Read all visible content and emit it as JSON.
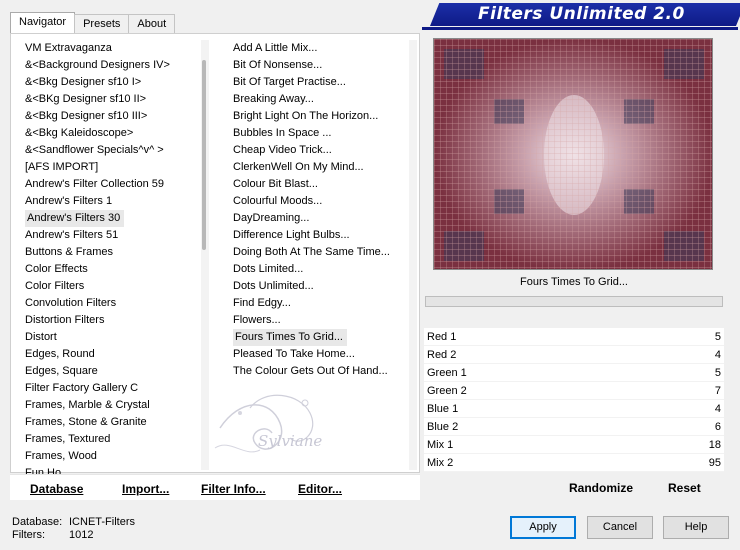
{
  "tabs": [
    {
      "label": "Navigator"
    },
    {
      "label": "Presets"
    },
    {
      "label": "About"
    }
  ],
  "brand": {
    "title": "Filters Unlimited 2.0"
  },
  "categories": [
    "VM Extravaganza",
    "&<Background Designers IV>",
    "&<Bkg Designer sf10 I>",
    "&<BKg Designer sf10 II>",
    "&<Bkg Designer sf10 III>",
    "&<Bkg Kaleidoscope>",
    "&<Sandflower Specials^v^ >",
    "[AFS IMPORT]",
    "Andrew's Filter Collection 59",
    "Andrew's Filters 1",
    "Andrew's Filters 30",
    "Andrew's Filters 51",
    "Buttons & Frames",
    "Color Effects",
    "Color Filters",
    "Convolution Filters",
    "Distortion Filters",
    "Distort",
    "Edges, Round",
    "Edges, Square",
    "Filter Factory Gallery C",
    "Frames, Marble & Crystal",
    "Frames, Stone & Granite",
    "Frames, Textured",
    "Frames, Wood",
    "Fun Ho..."
  ],
  "filters": [
    "Add A Little Mix...",
    "Bit Of Nonsense...",
    "Bit Of Target Practise...",
    "Breaking Away...",
    "Bright Light On The Horizon...",
    "Bubbles In Space ...",
    "Cheap Video Trick...",
    "ClerkenWell On My Mind...",
    "Colour Bit Blast...",
    "Colourful Moods...",
    "DayDreaming...",
    "Difference Light Bulbs...",
    "Doing Both At The Same Time...",
    "Dots Limited...",
    "Dots Unlimited...",
    "Find Edgy...",
    "Flowers...",
    "Fours Times To Grid...",
    "Pleased To Take Home...",
    "The Colour Gets Out Of Hand..."
  ],
  "watermark": {
    "text": "Sylviane"
  },
  "bottom_buttons": {
    "database": "Database",
    "import": "Import...",
    "filter_info": "Filter Info...",
    "editor": "Editor..."
  },
  "preview": {
    "filter_name": "Fours Times To Grid..."
  },
  "params": [
    {
      "name": "Red 1",
      "value": "5"
    },
    {
      "name": "Red 2",
      "value": "4"
    },
    {
      "name": "Green 1",
      "value": "5"
    },
    {
      "name": "Green 2",
      "value": "7"
    },
    {
      "name": "Blue 1",
      "value": "4"
    },
    {
      "name": "Blue 2",
      "value": "6"
    },
    {
      "name": "Mix 1",
      "value": "18"
    },
    {
      "name": "Mix 2",
      "value": "95"
    }
  ],
  "param_buttons": {
    "randomize": "Randomize",
    "reset": "Reset"
  },
  "status": {
    "database_label": "Database:",
    "database_value": "ICNET-Filters",
    "filters_label": "Filters:",
    "filters_value": "1012"
  },
  "dialog_buttons": {
    "apply": "Apply",
    "cancel": "Cancel",
    "help": "Help"
  },
  "colors": {
    "banner": "#0e1a86",
    "preview_base": "#7a3040",
    "grid_line": "#c89a9a"
  }
}
